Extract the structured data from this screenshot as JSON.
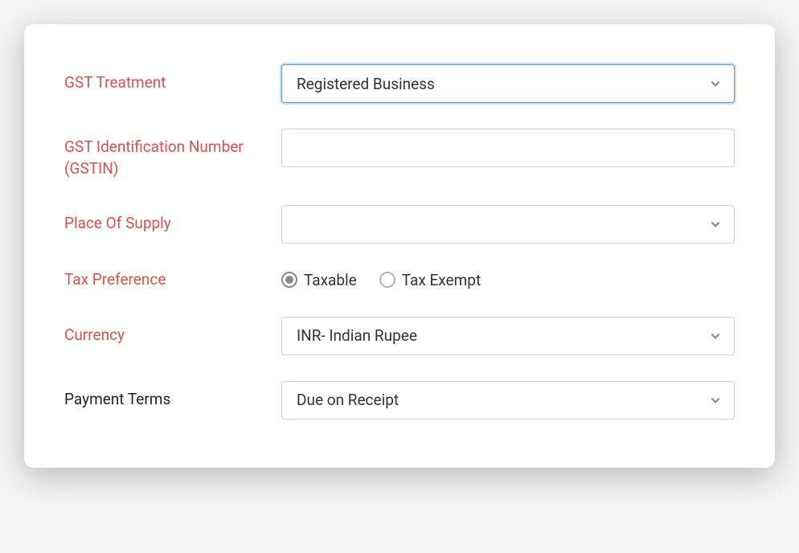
{
  "form": {
    "gst_treatment": {
      "label": "GST Treatment",
      "value": "Registered Business"
    },
    "gstin": {
      "label": "GST Identification Number (GSTIN)",
      "value": ""
    },
    "place_of_supply": {
      "label": "Place Of Supply",
      "value": ""
    },
    "tax_preference": {
      "label": "Tax Preference",
      "option_taxable": "Taxable",
      "option_exempt": "Tax Exempt",
      "selected": "taxable"
    },
    "currency": {
      "label": "Currency",
      "value": "INR- Indian Rupee"
    },
    "payment_terms": {
      "label": "Payment Terms",
      "value": "Due on Receipt"
    }
  }
}
